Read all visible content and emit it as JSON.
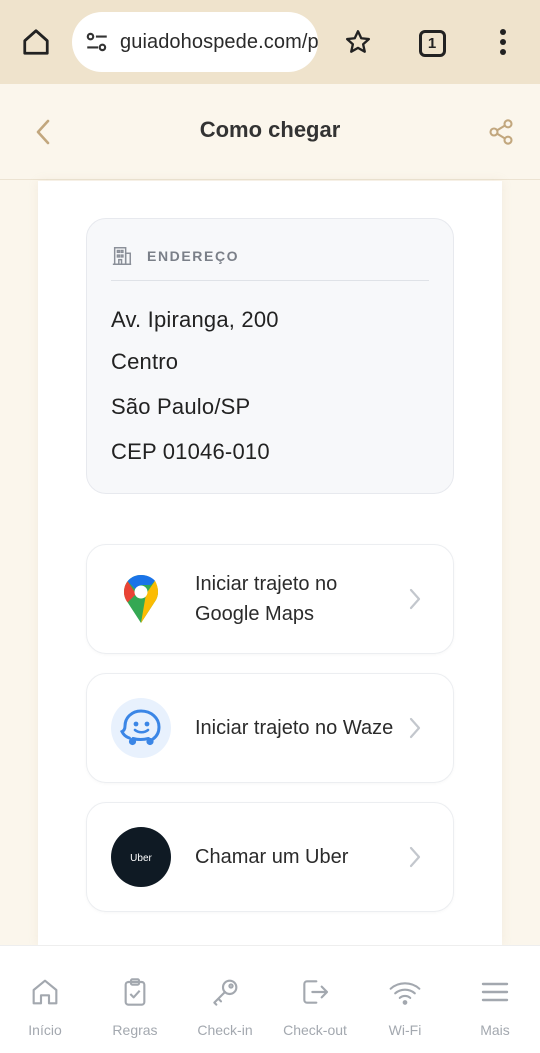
{
  "browser": {
    "url": "guiadohospede.com/p",
    "tab_count": "1"
  },
  "header": {
    "title": "Como chegar"
  },
  "address": {
    "label": "ENDEREÇO",
    "lines": [
      "Av. Ipiranga, 200",
      "Centro",
      "São Paulo/SP",
      "CEP 01046-010"
    ]
  },
  "actions": [
    {
      "label": "Iniciar trajeto no Google Maps",
      "icon": "google-maps-icon"
    },
    {
      "label": "Iniciar trajeto no Waze",
      "icon": "waze-icon"
    },
    {
      "label": "Chamar um Uber",
      "icon": "uber-icon",
      "icon_text": "Uber"
    }
  ],
  "nav": {
    "items": [
      {
        "label": "Início",
        "icon": "home-icon"
      },
      {
        "label": "Regras",
        "icon": "clipboard-icon"
      },
      {
        "label": "Check-in",
        "icon": "key-icon"
      },
      {
        "label": "Check-out",
        "icon": "exit-icon"
      },
      {
        "label": "Wi-Fi",
        "icon": "wifi-icon"
      },
      {
        "label": "Mais",
        "icon": "menu-icon"
      }
    ]
  },
  "colors": {
    "browser_bar": "#efe3cc",
    "accent": "#c2a77e",
    "nav_gray": "#a3a8af",
    "uber_bg": "#0f1a24",
    "waze_blue": "#3b86e6"
  }
}
